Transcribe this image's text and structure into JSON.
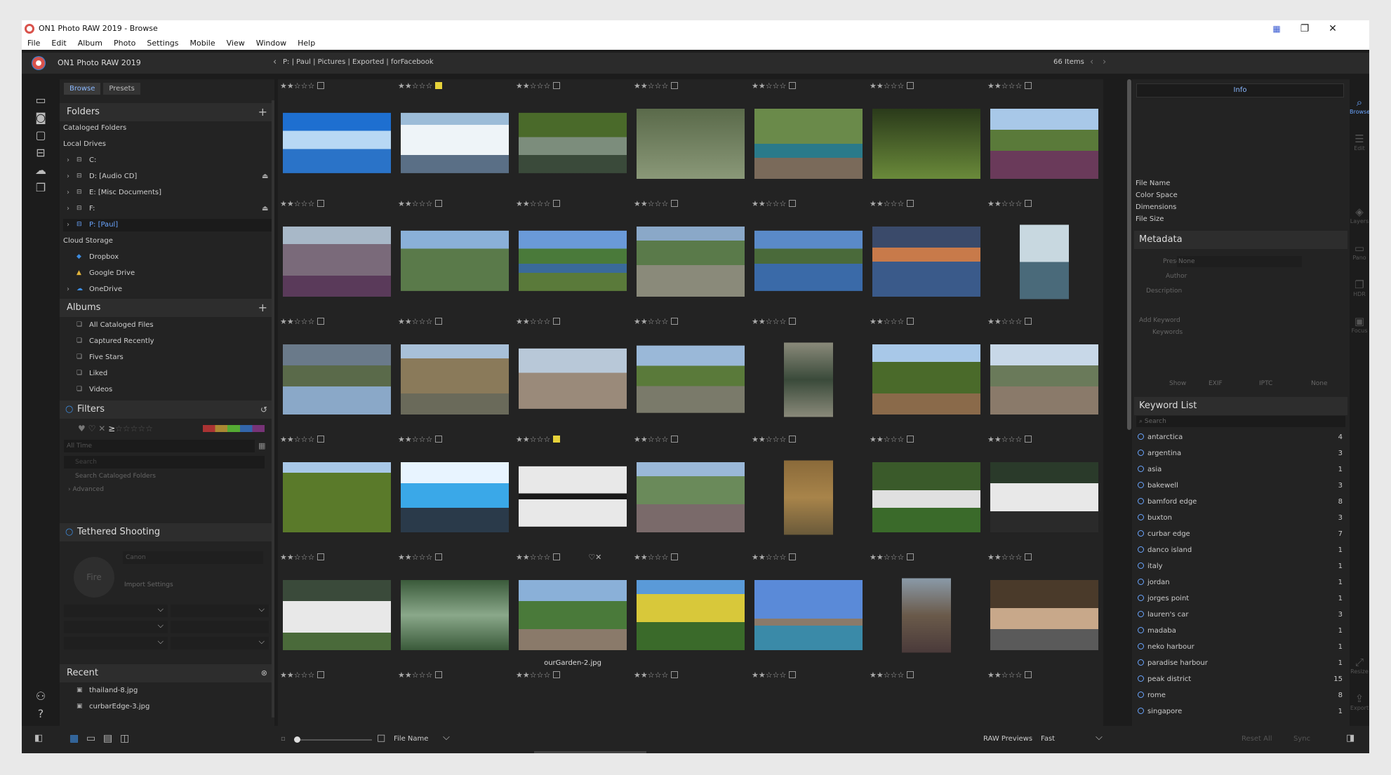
{
  "window": {
    "title": "ON1 Photo RAW 2019 - Browse",
    "controls": [
      "⬒",
      "❐",
      "✕"
    ]
  },
  "menu": [
    "File",
    "Edit",
    "Album",
    "Photo",
    "Settings",
    "Mobile",
    "View",
    "Window",
    "Help"
  ],
  "appbar": {
    "app_name": "ON1 Photo RAW 2019",
    "breadcrumb": "P: | Paul | Pictures | Exported | forFacebook",
    "item_count": "66 Items"
  },
  "left_panel": {
    "tabs": [
      "Browse",
      "Presets"
    ],
    "folders": {
      "title": "Folders",
      "cataloged": "Cataloged Folders",
      "local_drives": "Local Drives",
      "drives": [
        "C:",
        "D: [Audio CD]",
        "E: [Misc Documents]",
        "F:",
        "P: [Paul]"
      ],
      "cloud_storage": "Cloud Storage",
      "cloud": [
        "Dropbox",
        "Google Drive",
        "OneDrive"
      ]
    },
    "albums": {
      "title": "Albums",
      "items": [
        "All Cataloged Files",
        "Captured Recently",
        "Five Stars",
        "Liked",
        "Videos"
      ]
    },
    "filters": {
      "title": "Filters",
      "time": "All Time",
      "search_placeholder": "Search",
      "search_scope": "Search Cataloged Folders",
      "advanced": "Advanced"
    },
    "tethered": {
      "title": "Tethered Shooting",
      "camera": "Canon",
      "fire": "Fire",
      "import": "Import Settings"
    },
    "recent": {
      "title": "Recent",
      "items": [
        "thailand-8.jpg",
        "curbarEdge-3.jpg"
      ]
    }
  },
  "grid": {
    "rating_stars": "★★☆☆☆",
    "caption": "ourGarden-2.jpg"
  },
  "right_panel": {
    "info_tab": "Info",
    "file_info": [
      "File Name",
      "Color Space",
      "Dimensions",
      "File Size"
    ],
    "metadata": {
      "title": "Metadata",
      "preset_label": "Preset",
      "preset_value": "None",
      "author": "Author",
      "description": "Description",
      "add_keyword": "Add Keyword",
      "keywords": "Keywords",
      "show": "Show",
      "tabs": [
        "EXIF",
        "IPTC",
        "None"
      ]
    },
    "keyword_list": {
      "title": "Keyword List",
      "search_placeholder": "Search",
      "items": [
        [
          "antarctica",
          "4"
        ],
        [
          "argentina",
          "3"
        ],
        [
          "asia",
          "1"
        ],
        [
          "bakewell",
          "3"
        ],
        [
          "bamford edge",
          "8"
        ],
        [
          "buxton",
          "3"
        ],
        [
          "curbar edge",
          "7"
        ],
        [
          "danco island",
          "1"
        ],
        [
          "italy",
          "1"
        ],
        [
          "jordan",
          "1"
        ],
        [
          "jorges point",
          "1"
        ],
        [
          "lauren's car",
          "3"
        ],
        [
          "madaba",
          "1"
        ],
        [
          "neko harbour",
          "1"
        ],
        [
          "paradise harbour",
          "1"
        ],
        [
          "peak district",
          "15"
        ],
        [
          "rome",
          "8"
        ],
        [
          "singapore",
          "1"
        ]
      ]
    }
  },
  "right_strip": [
    "Browse",
    "Edit",
    "Layers",
    "Pano",
    "HDR",
    "Focus",
    "Resize",
    "Export"
  ],
  "bottom": {
    "sort_label": "File Name",
    "raw_previews": "RAW Previews",
    "raw_mode": "Fast",
    "reset": "Reset All",
    "sync": "Sync"
  }
}
